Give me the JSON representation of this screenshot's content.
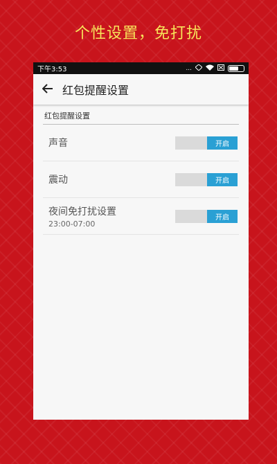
{
  "promo": {
    "title": "个性设置，免打扰"
  },
  "status_bar": {
    "time": "下午3:53",
    "dots": "..."
  },
  "app_bar": {
    "title": "红包提醒设置"
  },
  "section": {
    "title": "红包提醒设置"
  },
  "settings": [
    {
      "label": "声音",
      "toggle_label": "开启",
      "state": "on"
    },
    {
      "label": "震动",
      "toggle_label": "开启",
      "state": "on"
    },
    {
      "label": "夜间免打扰设置",
      "sublabel": "23:00-07:00",
      "toggle_label": "开启",
      "state": "on"
    }
  ],
  "colors": {
    "background_red": "#c8141c",
    "promo_text": "#f7e35a",
    "toggle_accent": "#2aa0d4"
  },
  "icons": [
    "back-arrow-icon",
    "signal-icon",
    "wifi-icon",
    "sim-icon",
    "battery-icon"
  ]
}
